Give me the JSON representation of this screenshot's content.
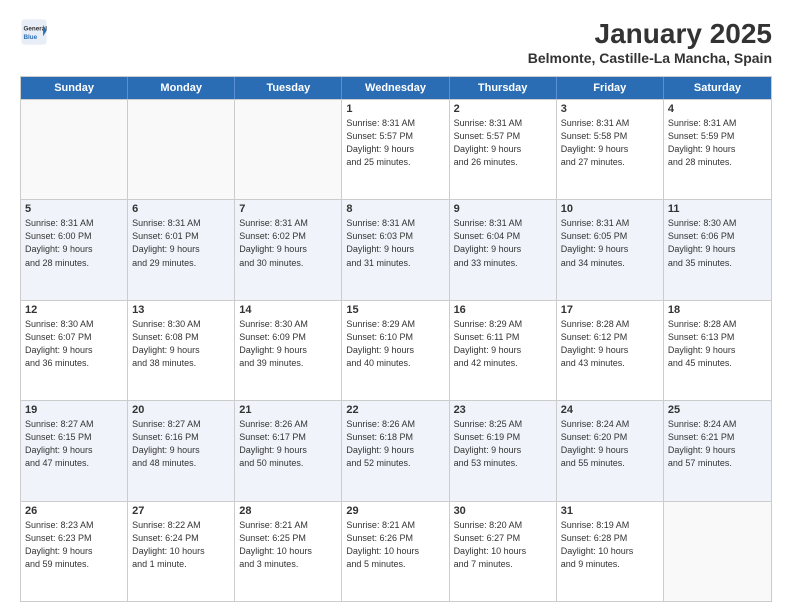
{
  "header": {
    "logo_general": "General",
    "logo_blue": "Blue",
    "month_title": "January 2025",
    "location": "Belmonte, Castille-La Mancha, Spain"
  },
  "weekdays": [
    "Sunday",
    "Monday",
    "Tuesday",
    "Wednesday",
    "Thursday",
    "Friday",
    "Saturday"
  ],
  "rows": [
    [
      {
        "day": "",
        "text": ""
      },
      {
        "day": "",
        "text": ""
      },
      {
        "day": "",
        "text": ""
      },
      {
        "day": "1",
        "text": "Sunrise: 8:31 AM\nSunset: 5:57 PM\nDaylight: 9 hours\nand 25 minutes."
      },
      {
        "day": "2",
        "text": "Sunrise: 8:31 AM\nSunset: 5:57 PM\nDaylight: 9 hours\nand 26 minutes."
      },
      {
        "day": "3",
        "text": "Sunrise: 8:31 AM\nSunset: 5:58 PM\nDaylight: 9 hours\nand 27 minutes."
      },
      {
        "day": "4",
        "text": "Sunrise: 8:31 AM\nSunset: 5:59 PM\nDaylight: 9 hours\nand 28 minutes."
      }
    ],
    [
      {
        "day": "5",
        "text": "Sunrise: 8:31 AM\nSunset: 6:00 PM\nDaylight: 9 hours\nand 28 minutes."
      },
      {
        "day": "6",
        "text": "Sunrise: 8:31 AM\nSunset: 6:01 PM\nDaylight: 9 hours\nand 29 minutes."
      },
      {
        "day": "7",
        "text": "Sunrise: 8:31 AM\nSunset: 6:02 PM\nDaylight: 9 hours\nand 30 minutes."
      },
      {
        "day": "8",
        "text": "Sunrise: 8:31 AM\nSunset: 6:03 PM\nDaylight: 9 hours\nand 31 minutes."
      },
      {
        "day": "9",
        "text": "Sunrise: 8:31 AM\nSunset: 6:04 PM\nDaylight: 9 hours\nand 33 minutes."
      },
      {
        "day": "10",
        "text": "Sunrise: 8:31 AM\nSunset: 6:05 PM\nDaylight: 9 hours\nand 34 minutes."
      },
      {
        "day": "11",
        "text": "Sunrise: 8:30 AM\nSunset: 6:06 PM\nDaylight: 9 hours\nand 35 minutes."
      }
    ],
    [
      {
        "day": "12",
        "text": "Sunrise: 8:30 AM\nSunset: 6:07 PM\nDaylight: 9 hours\nand 36 minutes."
      },
      {
        "day": "13",
        "text": "Sunrise: 8:30 AM\nSunset: 6:08 PM\nDaylight: 9 hours\nand 38 minutes."
      },
      {
        "day": "14",
        "text": "Sunrise: 8:30 AM\nSunset: 6:09 PM\nDaylight: 9 hours\nand 39 minutes."
      },
      {
        "day": "15",
        "text": "Sunrise: 8:29 AM\nSunset: 6:10 PM\nDaylight: 9 hours\nand 40 minutes."
      },
      {
        "day": "16",
        "text": "Sunrise: 8:29 AM\nSunset: 6:11 PM\nDaylight: 9 hours\nand 42 minutes."
      },
      {
        "day": "17",
        "text": "Sunrise: 8:28 AM\nSunset: 6:12 PM\nDaylight: 9 hours\nand 43 minutes."
      },
      {
        "day": "18",
        "text": "Sunrise: 8:28 AM\nSunset: 6:13 PM\nDaylight: 9 hours\nand 45 minutes."
      }
    ],
    [
      {
        "day": "19",
        "text": "Sunrise: 8:27 AM\nSunset: 6:15 PM\nDaylight: 9 hours\nand 47 minutes."
      },
      {
        "day": "20",
        "text": "Sunrise: 8:27 AM\nSunset: 6:16 PM\nDaylight: 9 hours\nand 48 minutes."
      },
      {
        "day": "21",
        "text": "Sunrise: 8:26 AM\nSunset: 6:17 PM\nDaylight: 9 hours\nand 50 minutes."
      },
      {
        "day": "22",
        "text": "Sunrise: 8:26 AM\nSunset: 6:18 PM\nDaylight: 9 hours\nand 52 minutes."
      },
      {
        "day": "23",
        "text": "Sunrise: 8:25 AM\nSunset: 6:19 PM\nDaylight: 9 hours\nand 53 minutes."
      },
      {
        "day": "24",
        "text": "Sunrise: 8:24 AM\nSunset: 6:20 PM\nDaylight: 9 hours\nand 55 minutes."
      },
      {
        "day": "25",
        "text": "Sunrise: 8:24 AM\nSunset: 6:21 PM\nDaylight: 9 hours\nand 57 minutes."
      }
    ],
    [
      {
        "day": "26",
        "text": "Sunrise: 8:23 AM\nSunset: 6:23 PM\nDaylight: 9 hours\nand 59 minutes."
      },
      {
        "day": "27",
        "text": "Sunrise: 8:22 AM\nSunset: 6:24 PM\nDaylight: 10 hours\nand 1 minute."
      },
      {
        "day": "28",
        "text": "Sunrise: 8:21 AM\nSunset: 6:25 PM\nDaylight: 10 hours\nand 3 minutes."
      },
      {
        "day": "29",
        "text": "Sunrise: 8:21 AM\nSunset: 6:26 PM\nDaylight: 10 hours\nand 5 minutes."
      },
      {
        "day": "30",
        "text": "Sunrise: 8:20 AM\nSunset: 6:27 PM\nDaylight: 10 hours\nand 7 minutes."
      },
      {
        "day": "31",
        "text": "Sunrise: 8:19 AM\nSunset: 6:28 PM\nDaylight: 10 hours\nand 9 minutes."
      },
      {
        "day": "",
        "text": ""
      }
    ]
  ]
}
